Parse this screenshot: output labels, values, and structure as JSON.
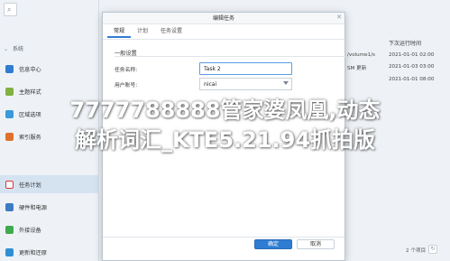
{
  "sidebar": {
    "section_label": "系统",
    "items": [
      {
        "label": "信息中心",
        "icon": "info-icon",
        "color": "#2f7cd3"
      },
      {
        "label": "主题样式",
        "icon": "theme-icon",
        "color": "#7fb241"
      },
      {
        "label": "区域选项",
        "icon": "region-icon",
        "color": "#3a9ad9"
      },
      {
        "label": "索引服务",
        "icon": "index-icon",
        "color": "#e0702e"
      },
      {
        "label": "任务计划",
        "icon": "calendar-check-icon",
        "color": "#d9383a"
      },
      {
        "label": "硬件和电源",
        "icon": "hardware-icon",
        "color": "#3d7bc4"
      },
      {
        "label": "外接设备",
        "icon": "usb-icon",
        "color": "#3eaa4e"
      },
      {
        "label": "更新和还原",
        "icon": "update-icon",
        "color": "#2f8fd3"
      }
    ]
  },
  "background_list": {
    "column_header": "下次运行时间",
    "rows": [
      {
        "left": "/volume1/s",
        "right": "2021-01-01 02:00"
      },
      {
        "left": "SM 更新",
        "right": "2021-01-03 03:00"
      },
      {
        "left": "",
        "right": "2021-01-01 08:00"
      }
    ],
    "pager": "2 个项目"
  },
  "dialog": {
    "title": "编辑任务",
    "tabs": [
      "常规",
      "计划",
      "任务设置"
    ],
    "active_tab": 0,
    "section_title": "一般设置",
    "fields": {
      "task_name_label": "任务名称:",
      "task_name_value": "Task 2",
      "user_label": "用户账号:",
      "user_value": "nicai"
    },
    "buttons": {
      "ok": "确定",
      "cancel": "取消"
    }
  },
  "watermark": {
    "line1": "7777788888管家婆凤凰,动态",
    "line2": "解析词汇_KTE5.21.94抓拍版"
  }
}
